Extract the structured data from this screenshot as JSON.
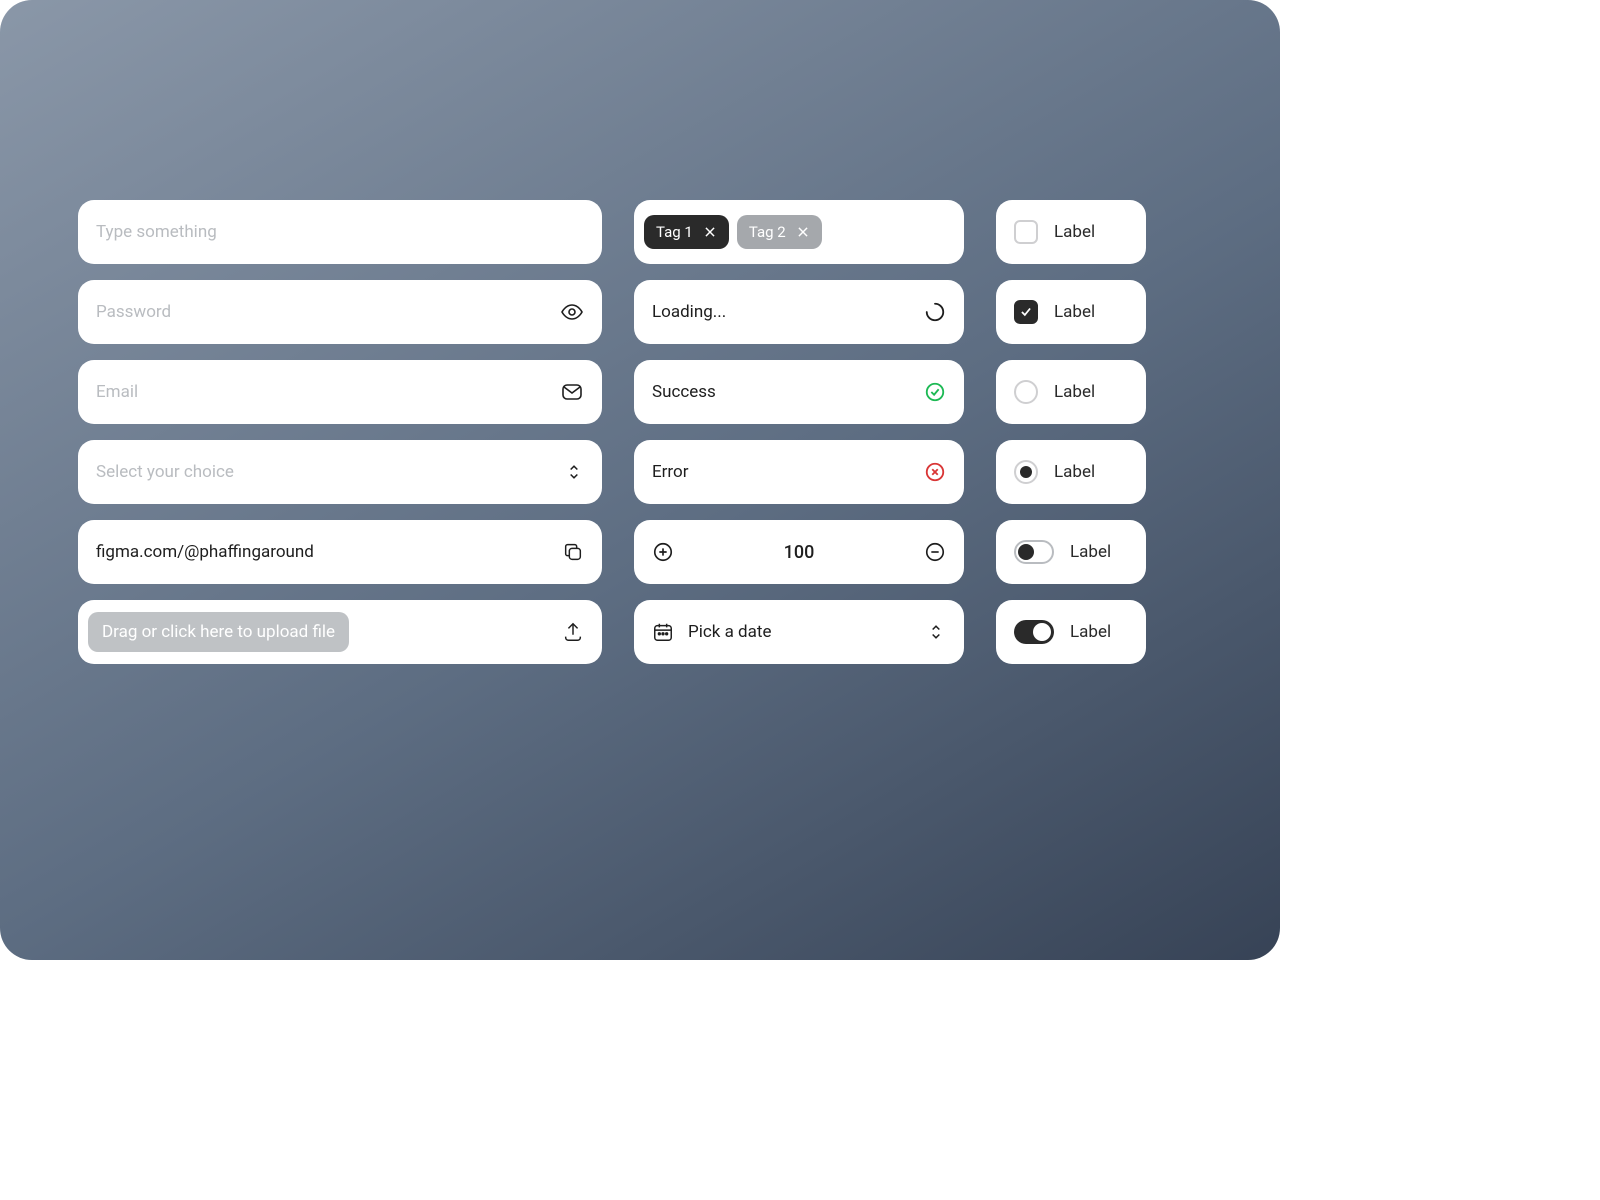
{
  "col1": {
    "text_placeholder": "Type something",
    "password_placeholder": "Password",
    "email_placeholder": "Email",
    "select_placeholder": "Select your choice",
    "url_value": "figma.com/@phaffingaround",
    "upload_label": "Drag or click here to upload file"
  },
  "col2": {
    "tags": [
      {
        "label": "Tag 1",
        "variant": "dark"
      },
      {
        "label": "Tag 2",
        "variant": "muted"
      }
    ],
    "loading_label": "Loading...",
    "success_label": "Success",
    "error_label": "Error",
    "stepper_value": "100",
    "date_placeholder": "Pick a date"
  },
  "col3": {
    "checkbox_unchecked_label": "Label",
    "checkbox_checked_label": "Label",
    "radio_unselected_label": "Label",
    "radio_selected_label": "Label",
    "switch_off_label": "Label",
    "switch_on_label": "Label"
  },
  "colors": {
    "success": "#1db954",
    "error": "#d93636"
  }
}
